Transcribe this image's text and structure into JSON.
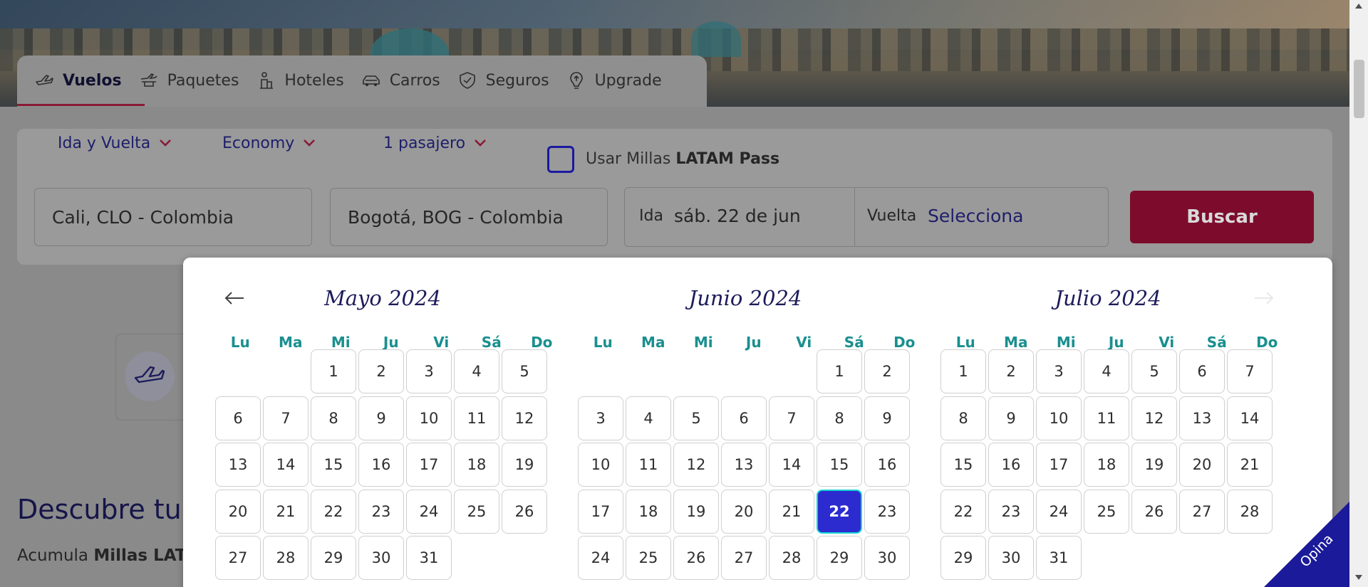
{
  "tabs": [
    {
      "label": "Vuelos",
      "icon": "plane-icon",
      "active": true
    },
    {
      "label": "Paquetes",
      "icon": "package-icon"
    },
    {
      "label": "Hoteles",
      "icon": "hotel-icon"
    },
    {
      "label": "Carros",
      "icon": "car-icon"
    },
    {
      "label": "Seguros",
      "icon": "shield-icon"
    },
    {
      "label": "Upgrade",
      "icon": "upgrade-icon"
    }
  ],
  "search": {
    "trip_type": "Ida y Vuelta",
    "cabin": "Economy",
    "passengers": "1 pasajero",
    "millas_prefix": "Usar Millas ",
    "millas_brand": "LATAM Pass",
    "origin": "Cali, CLO - Colombia",
    "destination": "Bogotá, BOG - Colombia",
    "ida_label": "Ida",
    "ida_value": "sáb. 22 de jun",
    "vuelta_label": "Vuelta",
    "vuelta_value": "Selecciona",
    "button": "Buscar"
  },
  "background": {
    "descubre": "Descubre tu",
    "acumula_prefix": "Acumula ",
    "acumula_bold": "Millas LATA"
  },
  "calendar": {
    "dow": [
      "Lu",
      "Ma",
      "Mi",
      "Ju",
      "Vi",
      "Sá",
      "Do"
    ],
    "months": [
      {
        "title": "Mayo 2024",
        "offset": 2,
        "days": 31
      },
      {
        "title": "Junio 2024",
        "offset": 5,
        "days": 30,
        "selected": 22
      },
      {
        "title": "Julio 2024",
        "offset": 0,
        "days": 31
      }
    ]
  },
  "feedback": {
    "label": "Opina"
  },
  "colors": {
    "accent": "#e8114b",
    "selected": "#2b2bd0",
    "navy": "#1b1b5a",
    "teal": "#1a8f8f"
  }
}
